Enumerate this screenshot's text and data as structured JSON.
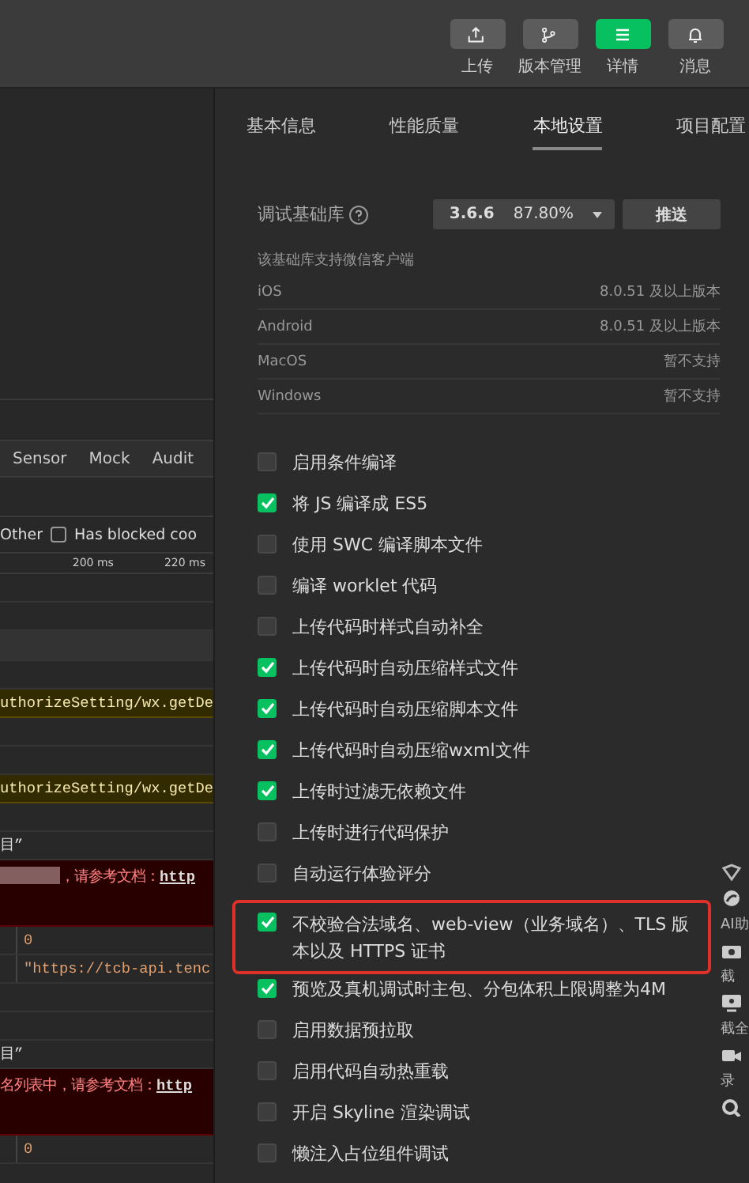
{
  "toolbar": [
    {
      "label": "上传",
      "selected": false
    },
    {
      "label": "版本管理",
      "selected": false
    },
    {
      "label": "详情",
      "selected": true
    },
    {
      "label": "消息",
      "selected": false
    }
  ],
  "console": {
    "tabs": [
      "Sensor",
      "Mock",
      "Audit"
    ],
    "filter": {
      "label": "Other",
      "checkbox_label": "Has blocked coo",
      "checked": false
    },
    "timeline": [
      "200 ms",
      "220 ms"
    ],
    "lines": [
      {
        "kind": "blank"
      },
      {
        "kind": "blank"
      },
      {
        "kind": "bar"
      },
      {
        "kind": "blank"
      },
      {
        "kind": "warning",
        "text": "uthorizeSetting/wx.getDe"
      },
      {
        "kind": "blank"
      },
      {
        "kind": "blank"
      },
      {
        "kind": "warning",
        "text": "uthorizeSetting/wx.getDe"
      },
      {
        "kind": "blank"
      },
      {
        "kind": "text",
        "text": "目”"
      },
      {
        "kind": "error",
        "text": "，请参考文档：",
        "link": "http",
        "redacted": true
      },
      {
        "kind": "cell",
        "text": "0"
      },
      {
        "kind": "cell",
        "text": "\"https://tcb-api.tenc"
      },
      {
        "kind": "blank"
      },
      {
        "kind": "blank"
      },
      {
        "kind": "text",
        "text": "目”"
      },
      {
        "kind": "error",
        "text": "名列表中，请参考文档：",
        "link": "http",
        "redacted": false
      },
      {
        "kind": "cell",
        "text": "0"
      }
    ]
  },
  "settings": {
    "tabs": [
      {
        "label": "基本信息",
        "selected": false
      },
      {
        "label": "性能质量",
        "selected": false
      },
      {
        "label": "本地设置",
        "selected": true
      },
      {
        "label": "项目配置",
        "selected": false
      }
    ],
    "base_library": {
      "label": "调试基础库",
      "version": "3.6.6",
      "share": "87.80%",
      "button": "推送"
    },
    "support": {
      "title": "该基础库支持微信客户端",
      "rows": [
        {
          "platform": "iOS",
          "value": "8.0.51 及以上版本"
        },
        {
          "platform": "Android",
          "value": "8.0.51 及以上版本"
        },
        {
          "platform": "MacOS",
          "value": "暂不支持"
        },
        {
          "platform": "Windows",
          "value": "暂不支持"
        }
      ]
    },
    "options": [
      {
        "label": "启用条件编译",
        "checked": false,
        "highlighted": false
      },
      {
        "label": "将 JS 编译成 ES5",
        "checked": true,
        "highlighted": false
      },
      {
        "label": "使用 SWC 编译脚本文件",
        "checked": false,
        "highlighted": false
      },
      {
        "label": "编译 worklet 代码",
        "checked": false,
        "highlighted": false
      },
      {
        "label": "上传代码时样式自动补全",
        "checked": false,
        "highlighted": false
      },
      {
        "label": "上传代码时自动压缩样式文件",
        "checked": true,
        "highlighted": false
      },
      {
        "label": "上传代码时自动压缩脚本文件",
        "checked": true,
        "highlighted": false
      },
      {
        "label": "上传代码时自动压缩wxml文件",
        "checked": true,
        "highlighted": false
      },
      {
        "label": "上传时过滤无依赖文件",
        "checked": true,
        "highlighted": false
      },
      {
        "label": "上传时进行代码保护",
        "checked": false,
        "highlighted": false
      },
      {
        "label": "自动运行体验评分",
        "checked": false,
        "highlighted": false
      },
      {
        "label": "不校验合法域名、web-view（业务域名）、TLS 版本以及 HTTPS 证书",
        "checked": true,
        "highlighted": true
      },
      {
        "label": "预览及真机调试时主包、分包体积上限调整为4M",
        "checked": true,
        "highlighted": false
      },
      {
        "label": "启用数据预拉取",
        "checked": false,
        "highlighted": false
      },
      {
        "label": "启用代码自动热重载",
        "checked": false,
        "highlighted": false
      },
      {
        "label": "开启 Skyline 渲染调试",
        "checked": false,
        "highlighted": false
      },
      {
        "label": "懒注入占位组件调试",
        "checked": false,
        "highlighted": false
      }
    ]
  },
  "side_tools": [
    "AI助",
    "截",
    "截全",
    "录"
  ]
}
